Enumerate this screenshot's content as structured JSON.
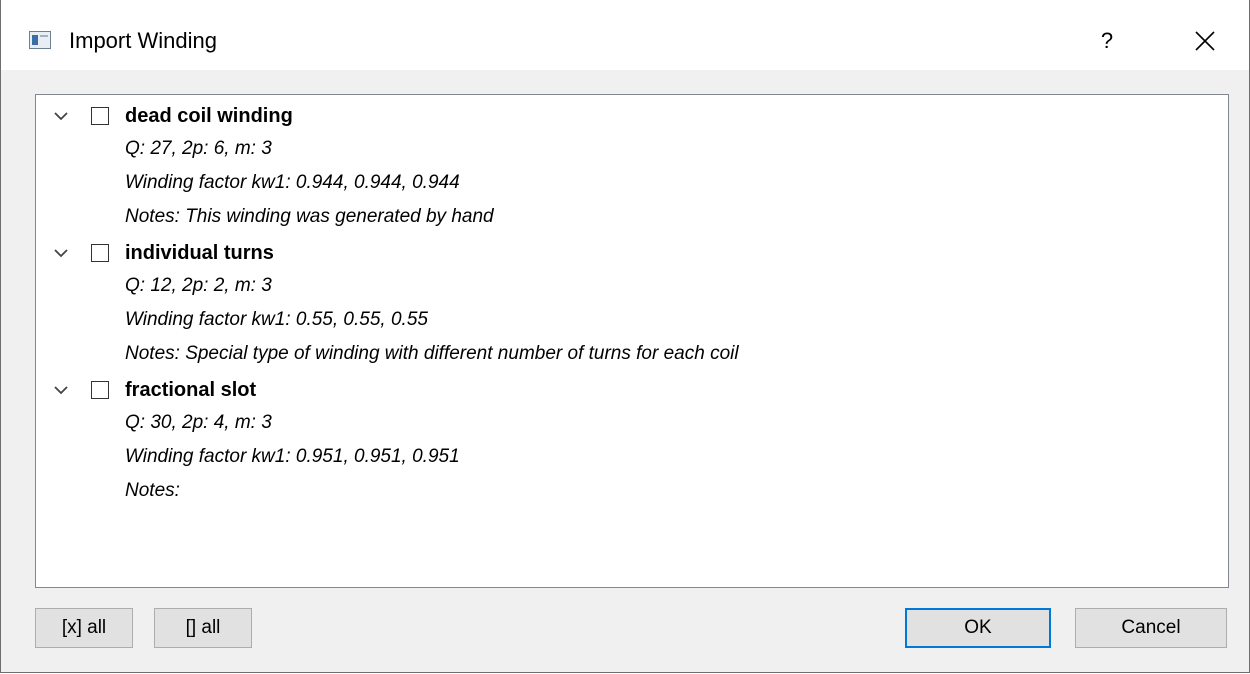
{
  "window": {
    "title": "Import Winding",
    "help_label": "?"
  },
  "tree": {
    "items": [
      {
        "title": "dead coil winding",
        "details": [
          "Q: 27, 2p: 6, m: 3",
          "Winding factor kw1: 0.944, 0.944, 0.944",
          "Notes: This winding was generated by hand"
        ],
        "expanded": true,
        "checked": false
      },
      {
        "title": "individual turns",
        "details": [
          "Q: 12, 2p: 2, m: 3",
          "Winding factor kw1: 0.55, 0.55, 0.55",
          "Notes: Special type of winding with different number of turns for each coil"
        ],
        "expanded": true,
        "checked": false
      },
      {
        "title": "fractional slot",
        "details": [
          "Q: 30, 2p: 4, m: 3",
          "Winding factor kw1: 0.951, 0.951, 0.951",
          "Notes:"
        ],
        "expanded": true,
        "checked": false
      }
    ]
  },
  "buttons": {
    "check_all": "[x] all",
    "uncheck_all": "[] all",
    "ok": "OK",
    "cancel": "Cancel"
  },
  "colors": {
    "accent": "#0078d7",
    "button_bg": "#e1e1e1",
    "dialog_bg": "#f0f0f0"
  }
}
